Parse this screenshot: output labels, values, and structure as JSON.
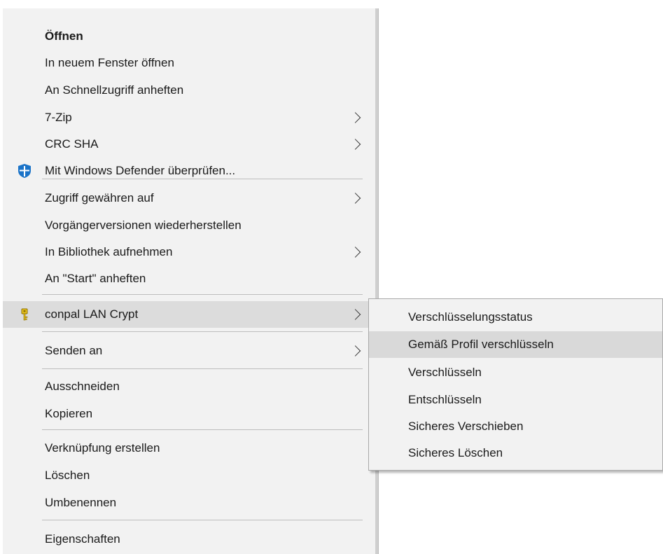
{
  "context_menu": {
    "items": [
      {
        "label": "Öffnen"
      },
      {
        "label": "In neuem Fenster öffnen"
      },
      {
        "label": "An Schnellzugriff anheften"
      },
      {
        "label": "7-Zip"
      },
      {
        "label": "CRC SHA"
      },
      {
        "label": "Mit Windows Defender überprüfen..."
      },
      {
        "label": "Zugriff gewähren auf"
      },
      {
        "label": "Vorgängerversionen wiederherstellen"
      },
      {
        "label": "In Bibliothek aufnehmen"
      },
      {
        "label": "An \"Start\" anheften"
      },
      {
        "label": "conpal LAN Crypt"
      },
      {
        "label": "Senden an"
      },
      {
        "label": "Ausschneiden"
      },
      {
        "label": "Kopieren"
      },
      {
        "label": "Verknüpfung erstellen"
      },
      {
        "label": "Löschen"
      },
      {
        "label": "Umbenennen"
      },
      {
        "label": "Eigenschaften"
      }
    ]
  },
  "submenu": {
    "parent": "conpal LAN Crypt",
    "hovered_item": "Gemäß Profil verschlüsseln",
    "items": [
      {
        "label": "Verschlüsselungsstatus"
      },
      {
        "label": "Gemäß Profil verschlüsseln"
      },
      {
        "label": "Verschlüsseln"
      },
      {
        "label": "Entschlüsseln"
      },
      {
        "label": "Sicheres Verschieben"
      },
      {
        "label": "Sicheres Löschen"
      }
    ]
  },
  "icons": {
    "defender": "windows-defender-shield-icon",
    "lan_crypt": "key-icon",
    "submenu_arrow": "chevron-right-icon"
  },
  "colors": {
    "menu_background": "#f2f2f2",
    "highlight": "#dcdcdc",
    "separator": "#bdbdbd",
    "defender_blue": "#1a73c8",
    "key_yellow": "#e8c21c"
  }
}
